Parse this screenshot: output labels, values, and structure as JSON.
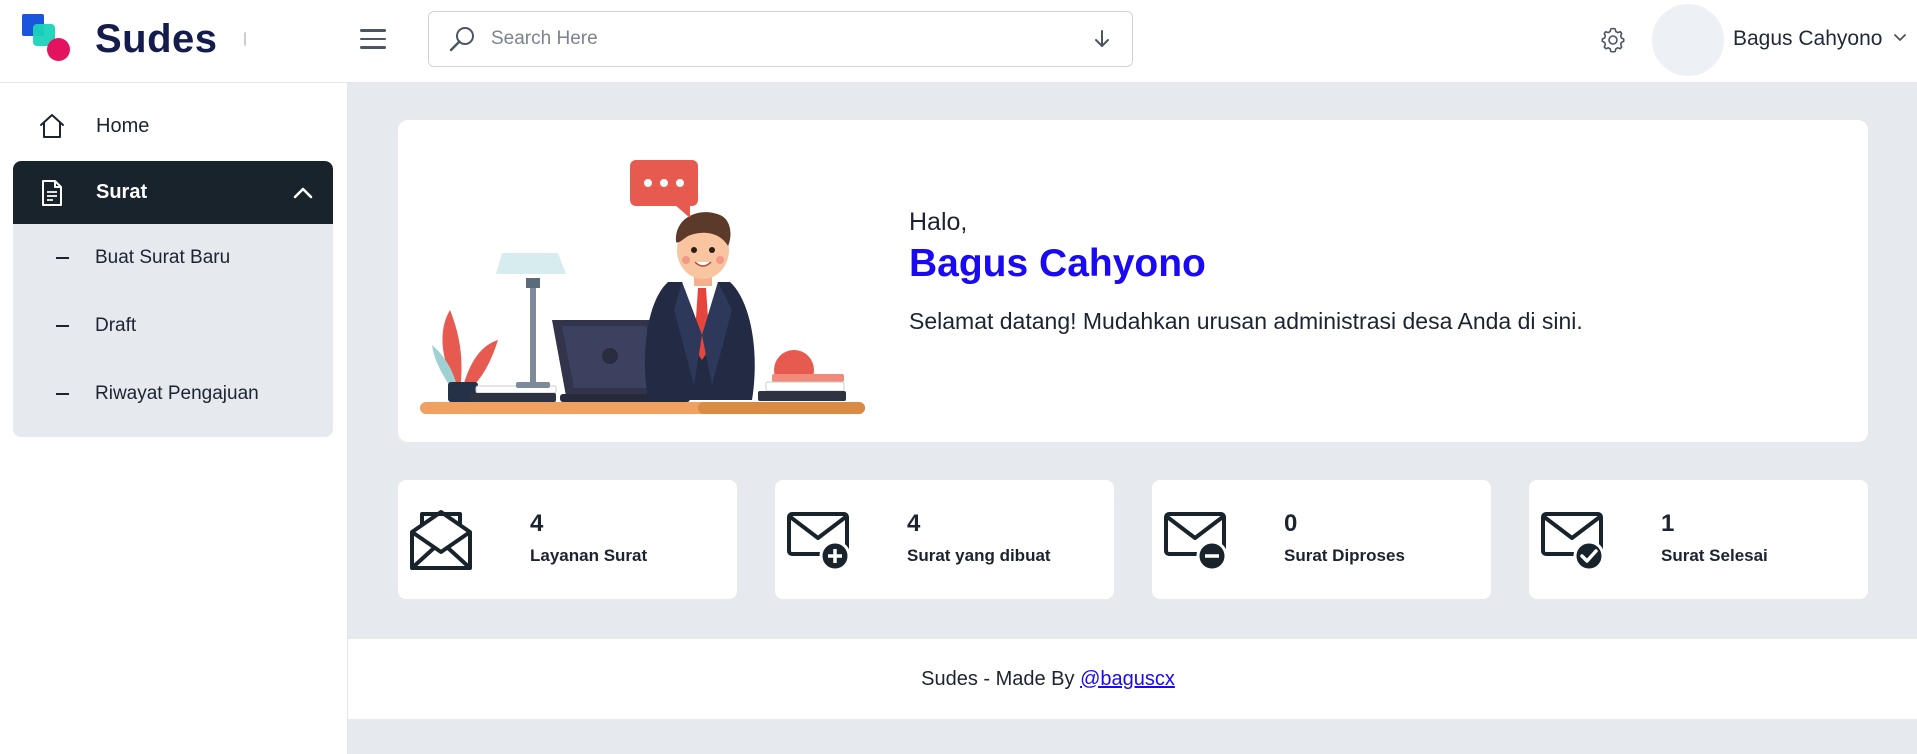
{
  "brand": {
    "name": "Sudes"
  },
  "search": {
    "placeholder": "Search Here",
    "value": ""
  },
  "user": {
    "name": "Bagus Cahyono"
  },
  "sidebar": {
    "home": {
      "label": "Home",
      "icon": "home-icon"
    },
    "surat": {
      "label": "Surat",
      "icon": "document-icon",
      "expanded": true
    },
    "sub_items": [
      {
        "label": "Buat Surat Baru"
      },
      {
        "label": "Draft"
      },
      {
        "label": "Riwayat Pengajuan"
      }
    ]
  },
  "welcome": {
    "greeting": "Halo,",
    "name": "Bagus Cahyono",
    "message": "Selamat datang! Mudahkan urusan administrasi desa Anda di sini."
  },
  "stats": [
    {
      "value": "4",
      "label": "Layanan Surat",
      "icon": "envelope-open-icon"
    },
    {
      "value": "4",
      "label": "Surat yang dibuat",
      "icon": "envelope-add-icon"
    },
    {
      "value": "0",
      "label": "Surat Diproses",
      "icon": "envelope-minus-icon"
    },
    {
      "value": "1",
      "label": "Surat Selesai",
      "icon": "envelope-check-icon"
    }
  ],
  "footer": {
    "text": "Sudes - Made By ",
    "link": "@baguscx"
  },
  "colors": {
    "accent": "#1a09f5",
    "sidebar_active": "#18232b",
    "background": "#e6e9ee",
    "brand_dark": "#141b4d"
  }
}
